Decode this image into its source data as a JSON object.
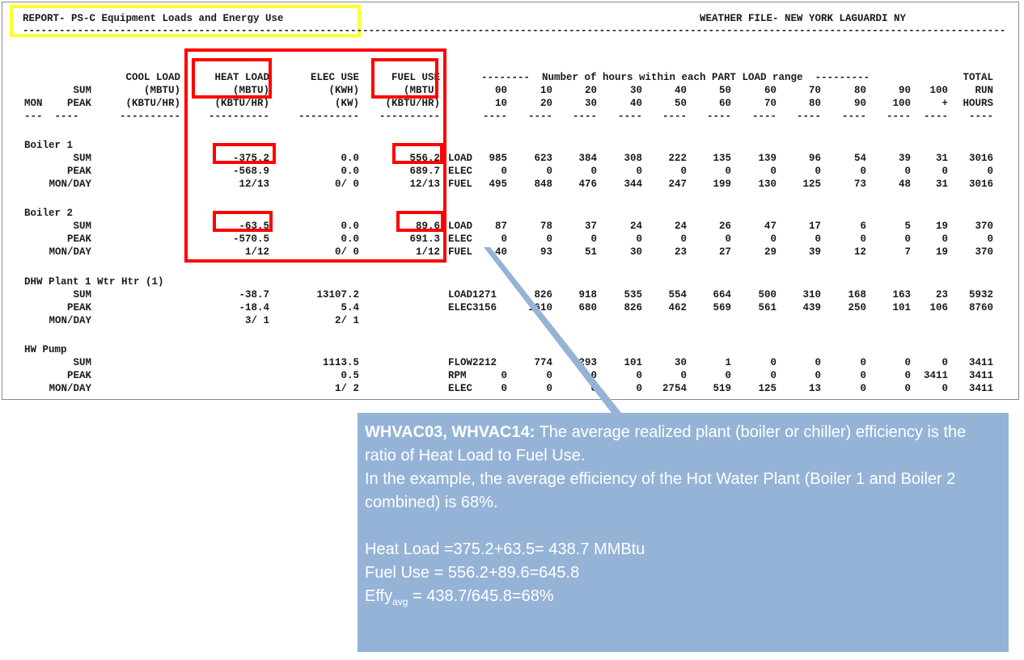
{
  "report": {
    "title": "REPORT- PS-C Equipment Loads and Energy Use",
    "weather": "WEATHER FILE- NEW YORK LAGUARDI NY",
    "columns": {
      "mon": "MON",
      "sum": "SUM",
      "peak": "PEAK",
      "cool_load": [
        "COOL LOAD",
        "(MBTU)",
        "(KBTU/HR)"
      ],
      "heat_load": [
        "HEAT LOAD",
        "(MBTU)",
        "(KBTU/HR)"
      ],
      "elec_use": [
        "ELEC USE",
        "(KWH)",
        "(KW)"
      ],
      "fuel_use": [
        "FUEL USE",
        "(MBTU)",
        "(KBTU/HR)"
      ],
      "part_load_header": "--------  Number of hours within each PART LOAD range  ---------",
      "total": [
        "TOTAL",
        "RUN",
        "HOURS"
      ],
      "range_low": [
        "00",
        "10",
        "20",
        "30",
        "40",
        "50",
        "60",
        "70",
        "80",
        "90",
        "100"
      ],
      "range_high": [
        "10",
        "20",
        "30",
        "40",
        "50",
        "60",
        "70",
        "80",
        "90",
        "100",
        "+"
      ]
    },
    "sections": [
      {
        "name": "Boiler 1",
        "rows": [
          {
            "label": "SUM",
            "heat": "-375.2",
            "elec": "0.0",
            "fuel": "556.2",
            "type": "LOAD",
            "hours": [
              "985",
              "623",
              "384",
              "308",
              "222",
              "135",
              "139",
              "96",
              "54",
              "39",
              "31"
            ],
            "total": "3016"
          },
          {
            "label": "PEAK",
            "heat": "-568.9",
            "elec": "0.0",
            "fuel": "689.7",
            "type": "ELEC",
            "hours": [
              "0",
              "0",
              "0",
              "0",
              "0",
              "0",
              "0",
              "0",
              "0",
              "0",
              "0"
            ],
            "total": "0"
          },
          {
            "label": "MON/DAY",
            "heat": "12/13",
            "elec": "0/ 0",
            "fuel": "12/13",
            "type": "FUEL",
            "hours": [
              "495",
              "848",
              "476",
              "344",
              "247",
              "199",
              "130",
              "125",
              "73",
              "48",
              "31"
            ],
            "total": "3016"
          }
        ]
      },
      {
        "name": "Boiler 2",
        "rows": [
          {
            "label": "SUM",
            "heat": "-63.5",
            "elec": "0.0",
            "fuel": "89.6",
            "type": "LOAD",
            "hours": [
              "87",
              "78",
              "37",
              "24",
              "24",
              "26",
              "47",
              "17",
              "6",
              "5",
              "19"
            ],
            "total": "370"
          },
          {
            "label": "PEAK",
            "heat": "-570.5",
            "elec": "0.0",
            "fuel": "691.3",
            "type": "ELEC",
            "hours": [
              "0",
              "0",
              "0",
              "0",
              "0",
              "0",
              "0",
              "0",
              "0",
              "0",
              "0"
            ],
            "total": "0"
          },
          {
            "label": "MON/DAY",
            "heat": "1/12",
            "elec": "0/ 0",
            "fuel": "1/12",
            "type": "FUEL",
            "hours": [
              "40",
              "93",
              "51",
              "30",
              "23",
              "27",
              "29",
              "39",
              "12",
              "7",
              "19"
            ],
            "total": "370"
          }
        ]
      },
      {
        "name": "DHW Plant 1 Wtr Htr (1)",
        "rows": [
          {
            "label": "SUM",
            "heat": "-38.7",
            "elec": "13107.2",
            "fuel": "",
            "type": "LOAD1271",
            "hours": [
              "",
              "826",
              "918",
              "535",
              "554",
              "664",
              "500",
              "310",
              "168",
              "163",
              "23"
            ],
            "total": "5932"
          },
          {
            "label": "PEAK",
            "heat": "-18.4",
            "elec": "5.4",
            "fuel": "",
            "type": "ELEC3156",
            "hours": [
              "",
              "1610",
              "680",
              "826",
              "462",
              "569",
              "561",
              "439",
              "250",
              "101",
              "106"
            ],
            "total": "8760"
          },
          {
            "label": "MON/DAY",
            "heat": "3/ 1",
            "elec": "2/ 1",
            "fuel": "",
            "type": "",
            "hours": [
              "",
              "",
              "",
              "",
              "",
              "",
              "",
              "",
              "",
              "",
              ""
            ],
            "total": ""
          }
        ]
      },
      {
        "name": "HW Pump",
        "rows": [
          {
            "label": "SUM",
            "heat": "",
            "elec": "1113.5",
            "fuel": "",
            "type": "FLOW2212",
            "hours": [
              "",
              "774",
              "293",
              "101",
              "30",
              "1",
              "0",
              "0",
              "0",
              "0",
              "0"
            ],
            "total": "3411"
          },
          {
            "label": "PEAK",
            "heat": "",
            "elec": "0.5",
            "fuel": "",
            "type": "RPM",
            "hours": [
              "0",
              "0",
              "0",
              "0",
              "0",
              "0",
              "0",
              "0",
              "0",
              "0",
              "3411"
            ],
            "total": "3411"
          },
          {
            "label": "MON/DAY",
            "heat": "",
            "elec": "1/ 2",
            "fuel": "",
            "type": "ELEC",
            "hours": [
              "0",
              "0",
              "0",
              "0",
              "2754",
              "519",
              "125",
              "13",
              "0",
              "0",
              "0"
            ],
            "total": "3411"
          }
        ]
      }
    ]
  },
  "callout": {
    "heading": "WHVAC03, WHVAC14:",
    "line1": " The average realized plant (boiler or chiller) efficiency is the ratio of Heat Load to Fuel Use.",
    "line2": "In the example, the average efficiency of the Hot Water Plant (Boiler 1 and Boiler 2 combined) is 68%.",
    "calc1": "Heat Load =375.2+63.5= 438.7 MMBtu",
    "calc2": "Fuel Use = 556.2+89.6=645.8",
    "calc3_prefix": "Effy",
    "calc3_sub": "avg",
    "calc3_suffix": " = 438.7/645.8=68%"
  },
  "colors": {
    "highlight_yellow": "#ffff2b",
    "highlight_red": "#ff0000",
    "callout_bg": "#95b3d7"
  }
}
